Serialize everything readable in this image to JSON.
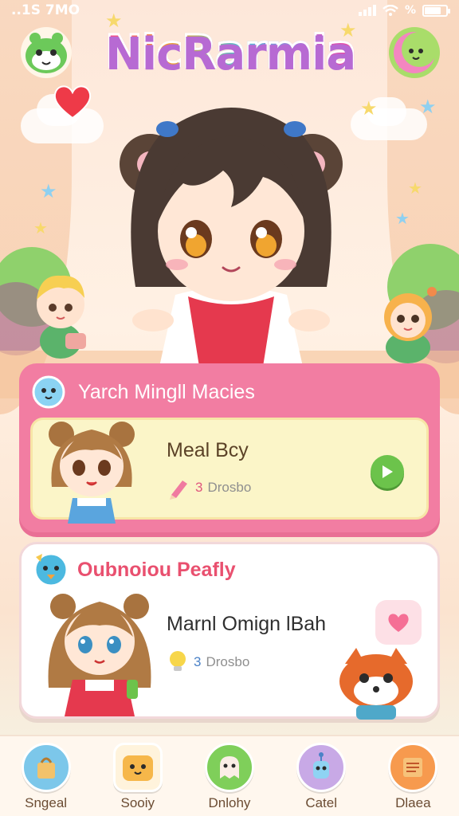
{
  "status_bar": {
    "left_text": "..1S 7MO",
    "right_text": "%"
  },
  "app": {
    "logo_text": "NicRarmia"
  },
  "card_featured": {
    "title": "Yarch Mingll Macies",
    "item": {
      "name": "Meal Bcy",
      "meta_count": "3",
      "meta_label": "Drosbo"
    }
  },
  "card_secondary": {
    "title": "Oubnoiou Peafly",
    "item": {
      "name": "Marnl Omign lBah",
      "meta_count": "3",
      "meta_label": "Drosbo"
    }
  },
  "bottom_nav": [
    {
      "label": "Sngeal",
      "icon": "bag-icon",
      "color": "#7cc7ea"
    },
    {
      "label": "Sooiy",
      "icon": "toast-character-icon",
      "color": "#f6b74a"
    },
    {
      "label": "Dnlohy",
      "icon": "ghost-character-icon",
      "color": "#7fcf5a"
    },
    {
      "label": "Catel",
      "icon": "robot-character-icon",
      "color": "#c8a9e6"
    },
    {
      "label": "Dlaea",
      "icon": "notebook-icon",
      "color": "#f79a4e"
    }
  ],
  "colors": {
    "accent_pink": "#f27da2",
    "card_cream": "#fbf5c8",
    "play_green": "#6cc34b"
  }
}
